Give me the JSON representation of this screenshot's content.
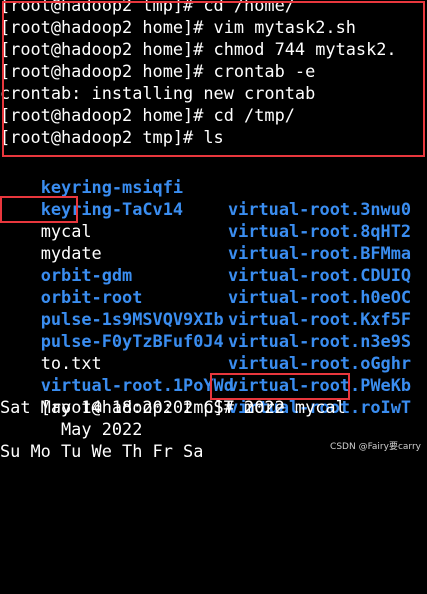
{
  "terminal": {
    "lines": [
      "[root@hadoop2 tmp]# cd /home/",
      "[root@hadoop2 home]# vim mytask2.sh",
      "[root@hadoop2 home]# chmod 744 mytask2.",
      "[root@hadoop2 home]# crontab -e",
      "crontab: installing new crontab",
      "[root@hadoop2 home]# cd /tmp/",
      "[root@hadoop2 tmp]# ls"
    ],
    "ls_rows": [
      {
        "left": "keyring-msiqfi",
        "right": "virtual-root.3nwu0"
      },
      {
        "left": "keyring-TaCv14",
        "right": "virtual-root.8qHT2"
      },
      {
        "left": "mycal",
        "right": "virtual-root.BFMma"
      },
      {
        "left": "mydate",
        "right": "virtual-root.CDUIQ"
      },
      {
        "left": "orbit-gdm",
        "right": "virtual-root.h0eOC"
      },
      {
        "left": "orbit-root",
        "right": "virtual-root.Kxf5F"
      },
      {
        "left": "pulse-1s9MSVQV9XIb",
        "right": "virtual-root.n3e9S"
      },
      {
        "left": "pulse-F0yTzBFuf0J4",
        "right": "virtual-root.oGghr"
      },
      {
        "left": "to.txt",
        "right": "virtual-root.PWeKb"
      },
      {
        "left": "virtual-root.1PoYWd",
        "right": "virtual-root.roIwT"
      }
    ],
    "more_prompt": "[root@hadoop2 tmp]# ",
    "more_cmd": "more mycal",
    "date_line": "Sat May 14 18:20:02 CST 2022",
    "cal_month": "      May 2022",
    "cal_days": "Su Mo Tu We Th Fr Sa"
  },
  "watermark": "CSDN @Fairy要carry",
  "colors": {
    "background": "#000000",
    "text": "#ffffff",
    "dir_blue": "#3a8df0",
    "highlight_red": "#e8373d"
  }
}
